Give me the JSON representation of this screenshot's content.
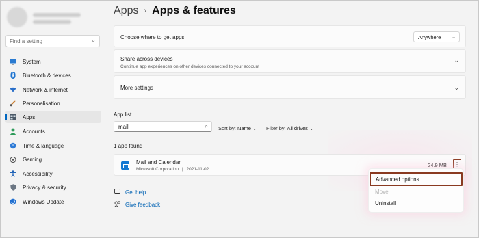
{
  "sidebar": {
    "search_placeholder": "Find a setting",
    "search_icon": "search-icon",
    "items": [
      {
        "label": "System",
        "icon": "monitor-icon"
      },
      {
        "label": "Bluetooth & devices",
        "icon": "bluetooth-icon"
      },
      {
        "label": "Network & internet",
        "icon": "wifi-icon"
      },
      {
        "label": "Personalisation",
        "icon": "brush-icon"
      },
      {
        "label": "Apps",
        "icon": "apps-icon",
        "active": true
      },
      {
        "label": "Accounts",
        "icon": "person-icon"
      },
      {
        "label": "Time & language",
        "icon": "globe-clock-icon"
      },
      {
        "label": "Gaming",
        "icon": "gamepad-icon"
      },
      {
        "label": "Accessibility",
        "icon": "accessibility-icon"
      },
      {
        "label": "Privacy & security",
        "icon": "shield-icon"
      },
      {
        "label": "Windows Update",
        "icon": "update-icon"
      }
    ]
  },
  "breadcrumb": {
    "parent": "Apps",
    "separator": "›",
    "current": "Apps & features"
  },
  "cards": {
    "where": {
      "title": "Choose where to get apps",
      "dropdown_value": "Anywhere"
    },
    "share": {
      "title": "Share across devices",
      "subtitle": "Continue app experiences on other devices connected to your account"
    },
    "more": {
      "title": "More settings"
    }
  },
  "app_list": {
    "label": "App list",
    "search_value": "mail",
    "sort_label": "Sort by:",
    "sort_value": "Name",
    "filter_label": "Filter by:",
    "filter_value": "All drives",
    "count_text": "1 app found"
  },
  "app": {
    "name": "Mail and Calendar",
    "publisher": "Microsoft Corporation",
    "separator": "|",
    "date": "2021-11-02",
    "size": "24.9 MB"
  },
  "context_menu": {
    "items": [
      {
        "label": "Advanced options",
        "enabled": true,
        "highlighted": true
      },
      {
        "label": "Move",
        "enabled": false
      },
      {
        "label": "Uninstall",
        "enabled": true
      }
    ]
  },
  "links": {
    "help": "Get help",
    "feedback": "Give feedback"
  },
  "colors": {
    "accent": "#0067c0",
    "link": "#0062b3",
    "highlight_border": "#8a3a21"
  }
}
